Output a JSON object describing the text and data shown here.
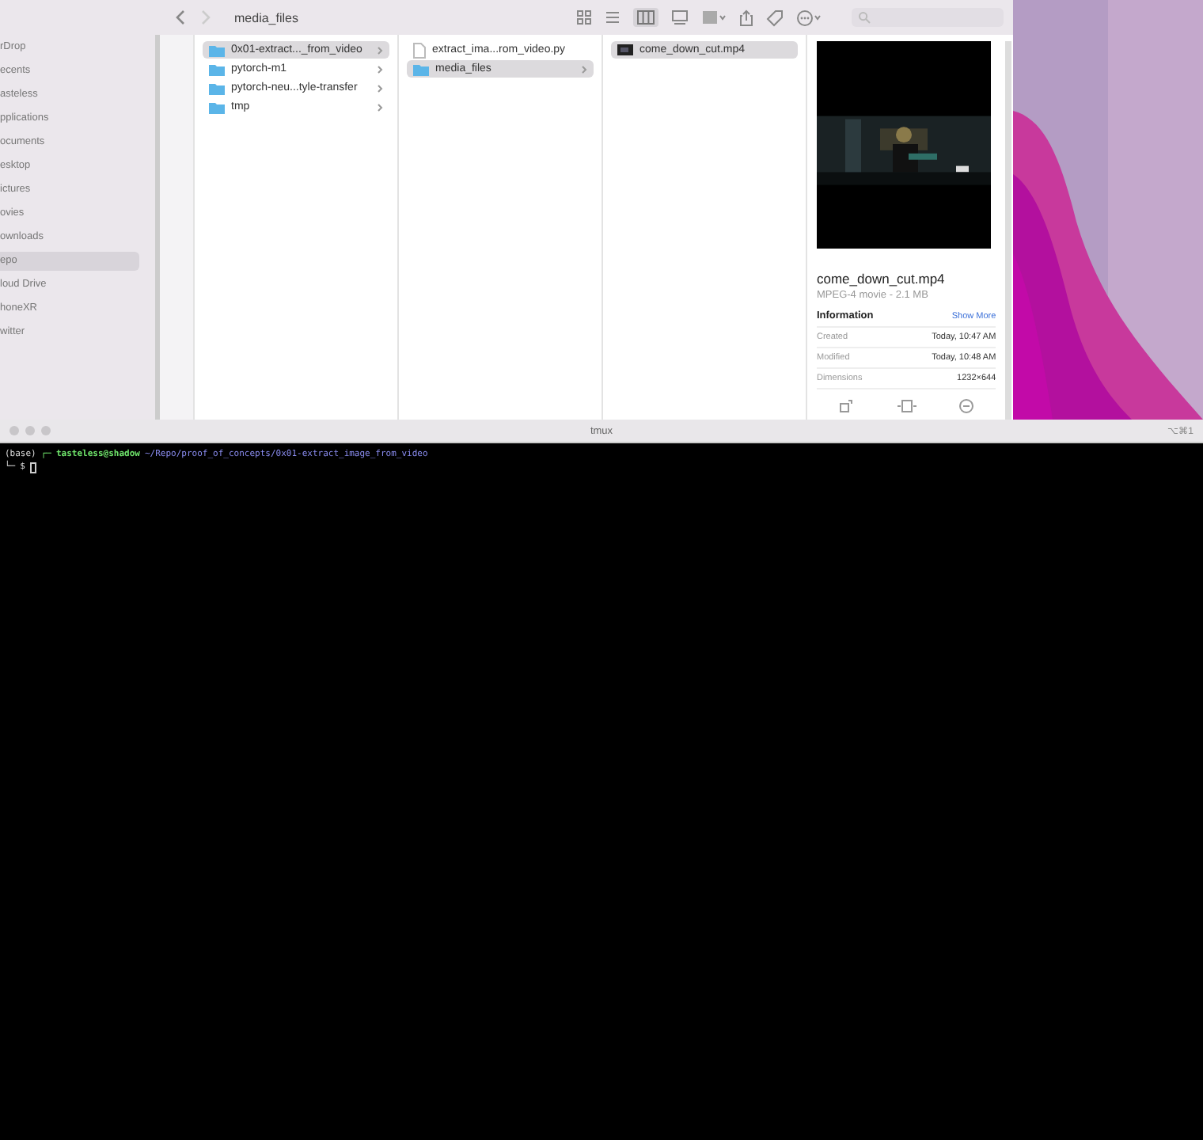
{
  "finder": {
    "title": "media_files",
    "sidebar": [
      {
        "label": "rDrop",
        "selected": false
      },
      {
        "label": "ecents",
        "selected": false
      },
      {
        "label": "asteless",
        "selected": false
      },
      {
        "label": "pplications",
        "selected": false
      },
      {
        "label": "ocuments",
        "selected": false
      },
      {
        "label": "esktop",
        "selected": false
      },
      {
        "label": "ictures",
        "selected": false
      },
      {
        "label": "ovies",
        "selected": false
      },
      {
        "label": "ownloads",
        "selected": false
      },
      {
        "label": "epo",
        "selected": true
      },
      {
        "label": "loud Drive",
        "selected": false
      },
      {
        "label": "honeXR",
        "selected": false
      },
      {
        "label": "witter",
        "selected": false
      }
    ],
    "columns": [
      [
        {
          "name": "0x01-extract..._from_video",
          "kind": "folder",
          "selected": true
        },
        {
          "name": "pytorch-m1",
          "kind": "folder",
          "selected": false
        },
        {
          "name": "pytorch-neu...tyle-transfer",
          "kind": "folder",
          "selected": false
        },
        {
          "name": "tmp",
          "kind": "folder",
          "selected": false
        }
      ],
      [
        {
          "name": "extract_ima...rom_video.py",
          "kind": "file",
          "selected": false
        },
        {
          "name": "media_files",
          "kind": "folder",
          "selected": true
        }
      ],
      [
        {
          "name": "come_down_cut.mp4",
          "kind": "video",
          "selected": true
        }
      ]
    ],
    "preview": {
      "name": "come_down_cut.mp4",
      "subtitle": "MPEG-4 movie - 2.1 MB",
      "section": "Information",
      "show_more": "Show More",
      "info": [
        {
          "label": "Created",
          "value": "Today, 10:47 AM"
        },
        {
          "label": "Modified",
          "value": "Today, 10:48 AM"
        },
        {
          "label": "Dimensions",
          "value": "1232×644"
        }
      ]
    }
  },
  "terminal": {
    "title": "tmux",
    "shortcut": "⌥⌘1",
    "env": "(base)",
    "corner_top": "┌─",
    "user": "tasteless@shadow",
    "path": "~/Repo/proof_of_concepts/0x01-extract_image_from_video",
    "corner_bottom": "└─",
    "prompt": "$"
  }
}
